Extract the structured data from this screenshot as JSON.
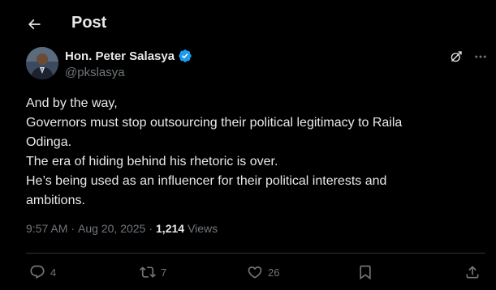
{
  "header": {
    "title": "Post",
    "back_icon": "arrow-left-icon"
  },
  "author": {
    "display_name": "Hon. Peter Salasya",
    "handle": "@pkslasya",
    "verified": true,
    "verified_color": "#1d9bf0"
  },
  "tweet": {
    "lines": [
      "And by the way,",
      "Governors must stop outsourcing their political legitimacy to Raila",
      "Odinga.",
      "The era of hiding behind his rhetoric is over.",
      "He’s being used as an influencer for their political interests and",
      "ambitions."
    ]
  },
  "meta": {
    "time": "9:57 AM",
    "sep1": "·",
    "date": "Aug 20, 2025",
    "sep2": "·",
    "views_count": "1,214",
    "views_label": "Views"
  },
  "actions": {
    "replies": "4",
    "reposts": "7",
    "likes": "26"
  },
  "colors": {
    "background": "#000000",
    "text": "#e7e9ea",
    "muted": "#71767b",
    "divider": "#2f3336"
  }
}
